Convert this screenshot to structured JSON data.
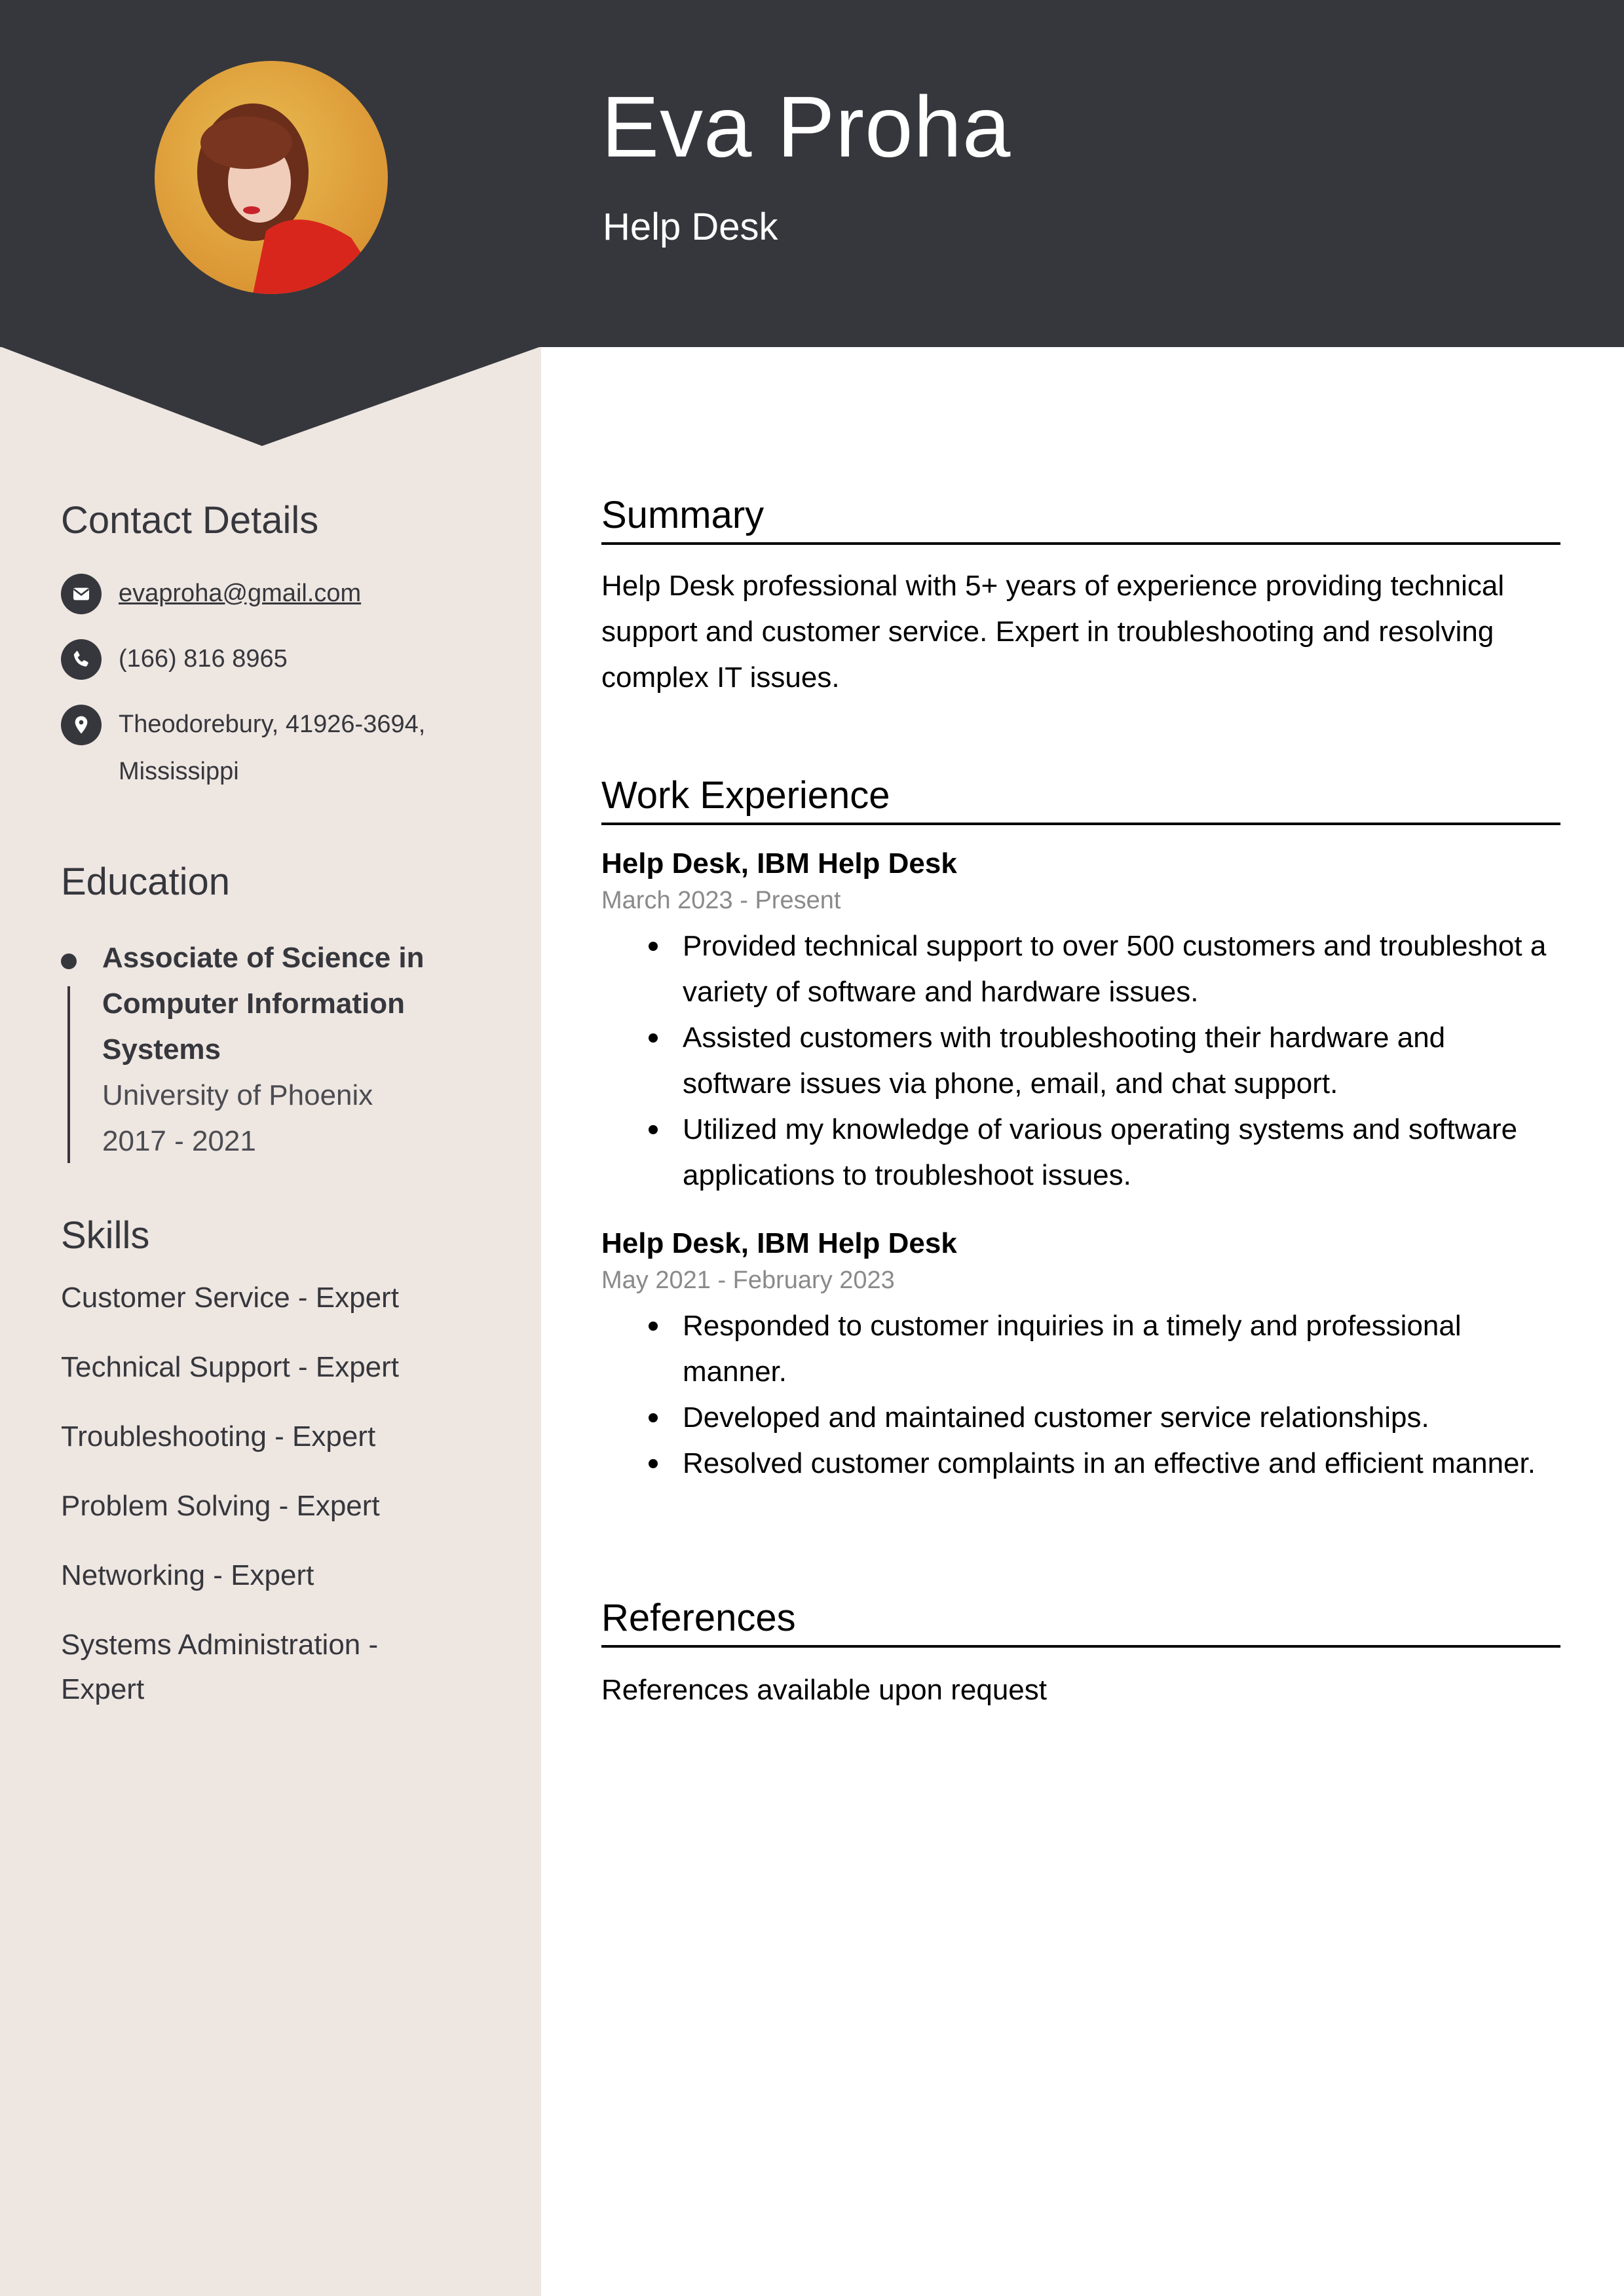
{
  "header": {
    "name": "Eva Proha",
    "title": "Help Desk",
    "photo_alt": "Profile photo"
  },
  "colors": {
    "header_bg": "#36373D",
    "sidebar_bg": "#EEE6E1",
    "text_dark": "#36373D",
    "muted": "#8A8A8A"
  },
  "contact": {
    "heading": "Contact Details",
    "items": [
      {
        "icon": "envelope-icon",
        "text": "evaproha@gmail.com"
      },
      {
        "icon": "phone-icon",
        "text": "(166) 816 8965"
      },
      {
        "icon": "location-pin-icon",
        "text": "Theodorebury, 41926-3694, Mississippi"
      }
    ]
  },
  "education": {
    "heading": "Education",
    "entries": [
      {
        "degree": "Associate of Science in Computer Information Systems",
        "school": "University of Phoenix",
        "years": "2017 - 2021"
      }
    ]
  },
  "skills": {
    "heading": "Skills",
    "items": [
      "Customer Service - Expert",
      "Technical Support - Expert",
      "Troubleshooting - Expert",
      "Problem Solving - Expert",
      "Networking - Expert",
      "Systems Administration - Expert"
    ]
  },
  "summary": {
    "heading": "Summary",
    "text": "Help Desk professional with 5+ years of experience providing technical support and customer service. Expert in troubleshooting and resolving complex IT issues."
  },
  "work": {
    "heading": "Work Experience",
    "jobs": [
      {
        "title": "Help Desk, IBM Help Desk",
        "dates": "March 2023 - Present",
        "bullets": [
          "Provided technical support to over 500 customers and troubleshot a variety of software and hardware issues.",
          "Assisted customers with troubleshooting their hardware and software issues via phone, email, and chat support.",
          "Utilized my knowledge of various operating systems and software applications to troubleshoot issues."
        ]
      },
      {
        "title": "Help Desk, IBM Help Desk",
        "dates": "May 2021 - February 2023",
        "bullets": [
          "Responded to customer inquiries in a timely and professional manner.",
          "Developed and maintained customer service relationships.",
          "Resolved customer complaints in an effective and efficient manner."
        ]
      }
    ]
  },
  "references": {
    "heading": "References",
    "text": "References available upon request"
  }
}
